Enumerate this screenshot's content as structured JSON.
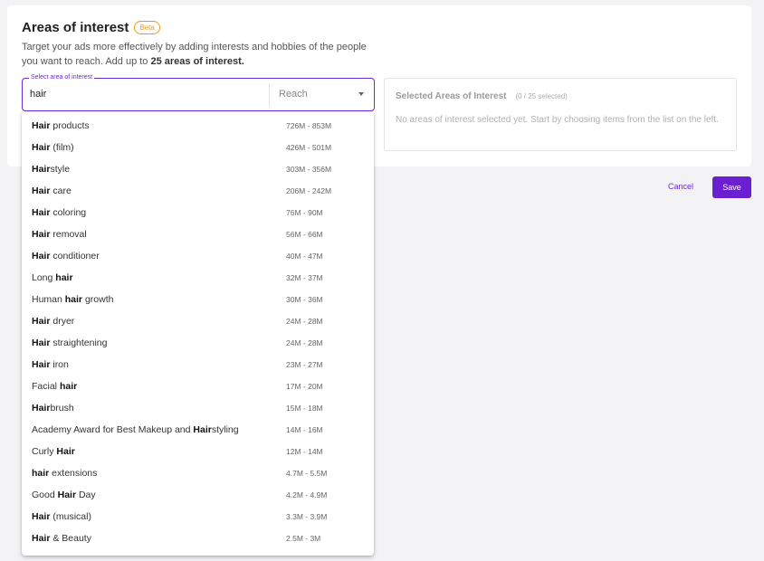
{
  "header": {
    "title": "Areas of interest",
    "badge": "Beta",
    "description_prefix": "Target your ads more effectively by adding interests and hobbies of the people you want to reach. Add up to ",
    "description_bold": "25 areas of interest."
  },
  "search": {
    "label": "Select area of interest",
    "value": "hair",
    "reach_label": "Reach"
  },
  "selected": {
    "title": "Selected Areas of Interest",
    "count": "(0 / 25 selected)",
    "empty_text": "No areas of interest selected yet. Start by choosing items from the list on the left."
  },
  "actions": {
    "cancel": "Cancel",
    "save": "Save"
  },
  "options": [
    {
      "parts": [
        {
          "t": "Hair",
          "b": true
        },
        {
          "t": " products",
          "b": false
        }
      ],
      "reach": "726M - 853M"
    },
    {
      "parts": [
        {
          "t": "Hair",
          "b": true
        },
        {
          "t": " (film)",
          "b": false
        }
      ],
      "reach": "426M - 501M"
    },
    {
      "parts": [
        {
          "t": "Hair",
          "b": true
        },
        {
          "t": "style",
          "b": false
        }
      ],
      "reach": "303M - 356M"
    },
    {
      "parts": [
        {
          "t": "Hair",
          "b": true
        },
        {
          "t": " care",
          "b": false
        }
      ],
      "reach": "206M - 242M"
    },
    {
      "parts": [
        {
          "t": "Hair",
          "b": true
        },
        {
          "t": " coloring",
          "b": false
        }
      ],
      "reach": "76M - 90M"
    },
    {
      "parts": [
        {
          "t": "Hair",
          "b": true
        },
        {
          "t": " removal",
          "b": false
        }
      ],
      "reach": "56M - 66M"
    },
    {
      "parts": [
        {
          "t": "Hair",
          "b": true
        },
        {
          "t": " conditioner",
          "b": false
        }
      ],
      "reach": "40M - 47M"
    },
    {
      "parts": [
        {
          "t": "Long ",
          "b": false
        },
        {
          "t": "hair",
          "b": true
        }
      ],
      "reach": "32M - 37M"
    },
    {
      "parts": [
        {
          "t": "Human ",
          "b": false
        },
        {
          "t": "hair",
          "b": true
        },
        {
          "t": " growth",
          "b": false
        }
      ],
      "reach": "30M - 36M"
    },
    {
      "parts": [
        {
          "t": "Hair",
          "b": true
        },
        {
          "t": " dryer",
          "b": false
        }
      ],
      "reach": "24M - 28M"
    },
    {
      "parts": [
        {
          "t": "Hair",
          "b": true
        },
        {
          "t": " straightening",
          "b": false
        }
      ],
      "reach": "24M - 28M"
    },
    {
      "parts": [
        {
          "t": "Hair",
          "b": true
        },
        {
          "t": " iron",
          "b": false
        }
      ],
      "reach": "23M - 27M"
    },
    {
      "parts": [
        {
          "t": "Facial ",
          "b": false
        },
        {
          "t": "hair",
          "b": true
        }
      ],
      "reach": "17M - 20M"
    },
    {
      "parts": [
        {
          "t": "Hair",
          "b": true
        },
        {
          "t": "brush",
          "b": false
        }
      ],
      "reach": "15M - 18M"
    },
    {
      "parts": [
        {
          "t": "Academy Award for Best Makeup and ",
          "b": false
        },
        {
          "t": "Hair",
          "b": true
        },
        {
          "t": "styling",
          "b": false
        }
      ],
      "reach": "14M - 16M"
    },
    {
      "parts": [
        {
          "t": "Curly ",
          "b": false
        },
        {
          "t": "Hair",
          "b": true
        }
      ],
      "reach": "12M - 14M"
    },
    {
      "parts": [
        {
          "t": "hair",
          "b": true
        },
        {
          "t": " extensions",
          "b": false
        }
      ],
      "reach": "4.7M - 5.5M"
    },
    {
      "parts": [
        {
          "t": "Good ",
          "b": false
        },
        {
          "t": "Hair",
          "b": true
        },
        {
          "t": " Day",
          "b": false
        }
      ],
      "reach": "4.2M - 4.9M"
    },
    {
      "parts": [
        {
          "t": "Hair",
          "b": true
        },
        {
          "t": " (musical)",
          "b": false
        }
      ],
      "reach": "3.3M - 3.9M"
    },
    {
      "parts": [
        {
          "t": "Hair",
          "b": true
        },
        {
          "t": " & Beauty",
          "b": false
        }
      ],
      "reach": "2.5M - 3M"
    }
  ]
}
